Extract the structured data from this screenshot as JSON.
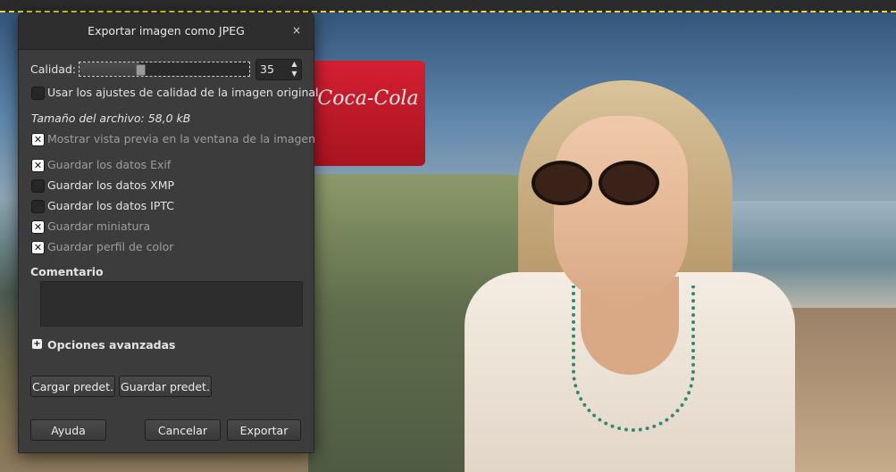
{
  "dialog": {
    "title": "Exportar imagen como JPEG",
    "close_icon": "×",
    "quality_label": "Calidad:",
    "quality_value": "35",
    "quality_fraction": 0.35,
    "use_original_quality_label": "Usar los ajustes de calidad de la imagen original",
    "file_size": "Tamaño del archivo: 58,0 kB",
    "preview_label": "Mostrar vista previa en la ventana de la imagen",
    "save_exif_label": "Guardar los datos Exif",
    "save_xmp_label": "Guardar los datos XMP",
    "save_iptc_label": "Guardar los datos IPTC",
    "save_thumbnail_label": "Guardar miniatura",
    "save_color_profile_label": "Guardar perfil de color",
    "comment_label": "Comentario",
    "comment_value": "",
    "advanced_label": "Opciones avanzadas",
    "load_defaults_label": "Cargar predet.",
    "save_defaults_label": "Guardar predet.",
    "help_label": "Ayuda",
    "cancel_label": "Cancelar",
    "export_label": "Exportar"
  },
  "checkboxes": {
    "use_original_quality": false,
    "preview": true,
    "save_exif": true,
    "save_xmp": false,
    "save_iptc": false,
    "save_thumbnail": true,
    "save_color_profile": true
  },
  "icons": {
    "close": "close-icon",
    "spin_up": "chevron-up-icon",
    "spin_down": "chevron-down-icon",
    "expander": "plus-icon"
  },
  "canvas": {
    "cooler_text": "Coca-Cola"
  },
  "colors": {
    "dialog_bg": "#3c3c3c",
    "titlebar_bg": "#2e2e2e",
    "text": "#e3e3e3",
    "dim_text": "#9d9d9d"
  }
}
